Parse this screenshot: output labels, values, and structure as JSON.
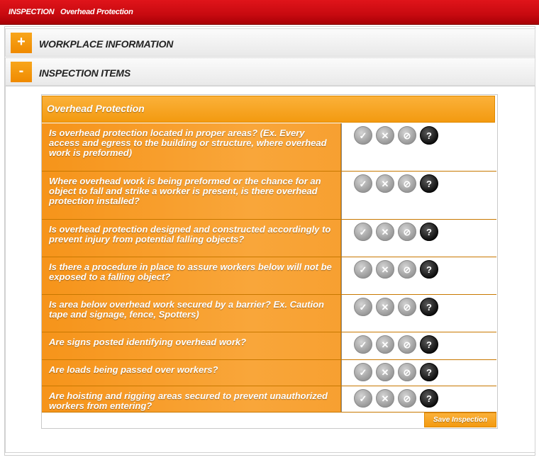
{
  "title_bar": {
    "section": "INSPECTION",
    "name": "Overhead Protection"
  },
  "sections": [
    {
      "toggle": "+",
      "label": "WORKPLACE INFORMATION"
    },
    {
      "toggle": "-",
      "label": "INSPECTION ITEMS"
    }
  ],
  "card": {
    "header": "Overhead Protection",
    "answer_icons": [
      "check-icon",
      "x-icon",
      "not-applicable-icon",
      "question-icon"
    ],
    "answer_glyphs": [
      "✓",
      "✕",
      "⊘",
      "?"
    ],
    "items": [
      {
        "question": "Is overhead protection located in proper areas? (Ex. Every access and egress to the building or structure, where overhead work is preformed)"
      },
      {
        "question": "Where overhead work is being preformed or the chance for an object to fall and strike a worker is present, is there overhead protection installed?"
      },
      {
        "question": "Is overhead protection designed and constructed accordingly to prevent injury from potential falling objects?"
      },
      {
        "question": "Is there a procedure in place to assure workers below will not be exposed to a falling object?"
      },
      {
        "question": "Is area below overhead work secured by a barrier? Ex. Caution tape and signage, fence, Spotters)"
      },
      {
        "question": "Are signs posted identifying overhead work?"
      },
      {
        "question": "Are loads being passed over workers?"
      },
      {
        "question": "Are hoisting and rigging areas secured to prevent unauthorized workers from entering?"
      }
    ],
    "save_label": "Save Inspection"
  },
  "colors": {
    "title_red": "#c80a10",
    "accent_orange": "#f39a10"
  }
}
